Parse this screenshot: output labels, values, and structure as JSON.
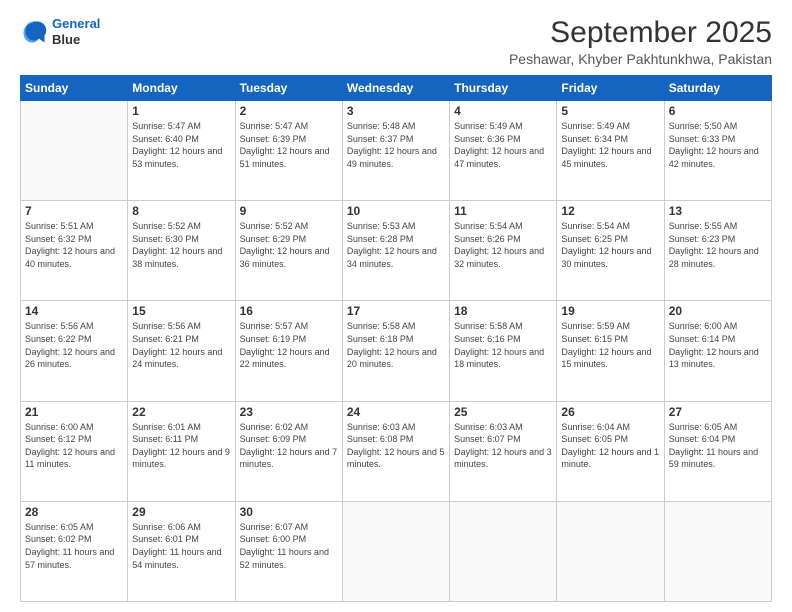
{
  "logo": {
    "line1": "General",
    "line2": "Blue"
  },
  "title": "September 2025",
  "location": "Peshawar, Khyber Pakhtunkhwa, Pakistan",
  "days_header": [
    "Sunday",
    "Monday",
    "Tuesday",
    "Wednesday",
    "Thursday",
    "Friday",
    "Saturday"
  ],
  "weeks": [
    [
      {
        "day": "",
        "sunrise": "",
        "sunset": "",
        "daylight": ""
      },
      {
        "day": "1",
        "sunrise": "Sunrise: 5:47 AM",
        "sunset": "Sunset: 6:40 PM",
        "daylight": "Daylight: 12 hours and 53 minutes."
      },
      {
        "day": "2",
        "sunrise": "Sunrise: 5:47 AM",
        "sunset": "Sunset: 6:39 PM",
        "daylight": "Daylight: 12 hours and 51 minutes."
      },
      {
        "day": "3",
        "sunrise": "Sunrise: 5:48 AM",
        "sunset": "Sunset: 6:37 PM",
        "daylight": "Daylight: 12 hours and 49 minutes."
      },
      {
        "day": "4",
        "sunrise": "Sunrise: 5:49 AM",
        "sunset": "Sunset: 6:36 PM",
        "daylight": "Daylight: 12 hours and 47 minutes."
      },
      {
        "day": "5",
        "sunrise": "Sunrise: 5:49 AM",
        "sunset": "Sunset: 6:34 PM",
        "daylight": "Daylight: 12 hours and 45 minutes."
      },
      {
        "day": "6",
        "sunrise": "Sunrise: 5:50 AM",
        "sunset": "Sunset: 6:33 PM",
        "daylight": "Daylight: 12 hours and 42 minutes."
      }
    ],
    [
      {
        "day": "7",
        "sunrise": "Sunrise: 5:51 AM",
        "sunset": "Sunset: 6:32 PM",
        "daylight": "Daylight: 12 hours and 40 minutes."
      },
      {
        "day": "8",
        "sunrise": "Sunrise: 5:52 AM",
        "sunset": "Sunset: 6:30 PM",
        "daylight": "Daylight: 12 hours and 38 minutes."
      },
      {
        "day": "9",
        "sunrise": "Sunrise: 5:52 AM",
        "sunset": "Sunset: 6:29 PM",
        "daylight": "Daylight: 12 hours and 36 minutes."
      },
      {
        "day": "10",
        "sunrise": "Sunrise: 5:53 AM",
        "sunset": "Sunset: 6:28 PM",
        "daylight": "Daylight: 12 hours and 34 minutes."
      },
      {
        "day": "11",
        "sunrise": "Sunrise: 5:54 AM",
        "sunset": "Sunset: 6:26 PM",
        "daylight": "Daylight: 12 hours and 32 minutes."
      },
      {
        "day": "12",
        "sunrise": "Sunrise: 5:54 AM",
        "sunset": "Sunset: 6:25 PM",
        "daylight": "Daylight: 12 hours and 30 minutes."
      },
      {
        "day": "13",
        "sunrise": "Sunrise: 5:55 AM",
        "sunset": "Sunset: 6:23 PM",
        "daylight": "Daylight: 12 hours and 28 minutes."
      }
    ],
    [
      {
        "day": "14",
        "sunrise": "Sunrise: 5:56 AM",
        "sunset": "Sunset: 6:22 PM",
        "daylight": "Daylight: 12 hours and 26 minutes."
      },
      {
        "day": "15",
        "sunrise": "Sunrise: 5:56 AM",
        "sunset": "Sunset: 6:21 PM",
        "daylight": "Daylight: 12 hours and 24 minutes."
      },
      {
        "day": "16",
        "sunrise": "Sunrise: 5:57 AM",
        "sunset": "Sunset: 6:19 PM",
        "daylight": "Daylight: 12 hours and 22 minutes."
      },
      {
        "day": "17",
        "sunrise": "Sunrise: 5:58 AM",
        "sunset": "Sunset: 6:18 PM",
        "daylight": "Daylight: 12 hours and 20 minutes."
      },
      {
        "day": "18",
        "sunrise": "Sunrise: 5:58 AM",
        "sunset": "Sunset: 6:16 PM",
        "daylight": "Daylight: 12 hours and 18 minutes."
      },
      {
        "day": "19",
        "sunrise": "Sunrise: 5:59 AM",
        "sunset": "Sunset: 6:15 PM",
        "daylight": "Daylight: 12 hours and 15 minutes."
      },
      {
        "day": "20",
        "sunrise": "Sunrise: 6:00 AM",
        "sunset": "Sunset: 6:14 PM",
        "daylight": "Daylight: 12 hours and 13 minutes."
      }
    ],
    [
      {
        "day": "21",
        "sunrise": "Sunrise: 6:00 AM",
        "sunset": "Sunset: 6:12 PM",
        "daylight": "Daylight: 12 hours and 11 minutes."
      },
      {
        "day": "22",
        "sunrise": "Sunrise: 6:01 AM",
        "sunset": "Sunset: 6:11 PM",
        "daylight": "Daylight: 12 hours and 9 minutes."
      },
      {
        "day": "23",
        "sunrise": "Sunrise: 6:02 AM",
        "sunset": "Sunset: 6:09 PM",
        "daylight": "Daylight: 12 hours and 7 minutes."
      },
      {
        "day": "24",
        "sunrise": "Sunrise: 6:03 AM",
        "sunset": "Sunset: 6:08 PM",
        "daylight": "Daylight: 12 hours and 5 minutes."
      },
      {
        "day": "25",
        "sunrise": "Sunrise: 6:03 AM",
        "sunset": "Sunset: 6:07 PM",
        "daylight": "Daylight: 12 hours and 3 minutes."
      },
      {
        "day": "26",
        "sunrise": "Sunrise: 6:04 AM",
        "sunset": "Sunset: 6:05 PM",
        "daylight": "Daylight: 12 hours and 1 minute."
      },
      {
        "day": "27",
        "sunrise": "Sunrise: 6:05 AM",
        "sunset": "Sunset: 6:04 PM",
        "daylight": "Daylight: 11 hours and 59 minutes."
      }
    ],
    [
      {
        "day": "28",
        "sunrise": "Sunrise: 6:05 AM",
        "sunset": "Sunset: 6:02 PM",
        "daylight": "Daylight: 11 hours and 57 minutes."
      },
      {
        "day": "29",
        "sunrise": "Sunrise: 6:06 AM",
        "sunset": "Sunset: 6:01 PM",
        "daylight": "Daylight: 11 hours and 54 minutes."
      },
      {
        "day": "30",
        "sunrise": "Sunrise: 6:07 AM",
        "sunset": "Sunset: 6:00 PM",
        "daylight": "Daylight: 11 hours and 52 minutes."
      },
      {
        "day": "",
        "sunrise": "",
        "sunset": "",
        "daylight": ""
      },
      {
        "day": "",
        "sunrise": "",
        "sunset": "",
        "daylight": ""
      },
      {
        "day": "",
        "sunrise": "",
        "sunset": "",
        "daylight": ""
      },
      {
        "day": "",
        "sunrise": "",
        "sunset": "",
        "daylight": ""
      }
    ]
  ]
}
